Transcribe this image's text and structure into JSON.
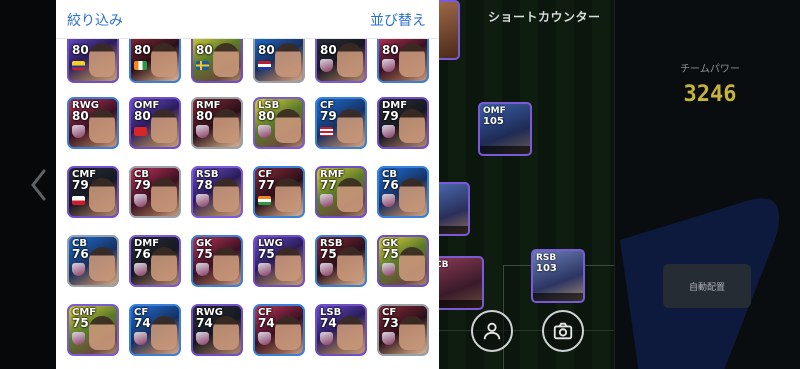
{
  "panel": {
    "filter_label": "絞り込み",
    "sort_label": "並び替え"
  },
  "background": {
    "formation_title": "ショートカウンター",
    "team_power_label": "チームパワー",
    "team_power_value": "3246",
    "auto_assign_label": "自動配置",
    "pitch_players": [
      {
        "pos": "OMF",
        "rating": "105"
      },
      {
        "pos": "RSB",
        "rating": "103"
      },
      {
        "pos": "CB",
        "rating": ""
      },
      {
        "pos": "",
        "rating": ""
      },
      {
        "pos": "",
        "rating": ""
      }
    ]
  },
  "roster": [
    {
      "pos": "",
      "rating": "80",
      "badge": "flag-colombia"
    },
    {
      "pos": "",
      "rating": "80",
      "badge": "flag-ivory-coast"
    },
    {
      "pos": "",
      "rating": "80",
      "badge": "flag-sweden"
    },
    {
      "pos": "",
      "rating": "80",
      "badge": "flag-netherlands"
    },
    {
      "pos": "",
      "rating": "80",
      "badge": "club-crest"
    },
    {
      "pos": "",
      "rating": "80",
      "badge": "club-crest"
    },
    {
      "pos": "RWG",
      "rating": "80",
      "badge": "club-crest"
    },
    {
      "pos": "OMF",
      "rating": "80",
      "badge": "flag-switzerland"
    },
    {
      "pos": "RMF",
      "rating": "80",
      "badge": "club-crest"
    },
    {
      "pos": "LSB",
      "rating": "80",
      "badge": "club-crest"
    },
    {
      "pos": "CF",
      "rating": "79",
      "badge": "flag-malaysia"
    },
    {
      "pos": "DMF",
      "rating": "79",
      "badge": "club-crest"
    },
    {
      "pos": "CMF",
      "rating": "79",
      "badge": "flag-czech"
    },
    {
      "pos": "CB",
      "rating": "79",
      "badge": "club-crest"
    },
    {
      "pos": "RSB",
      "rating": "78",
      "badge": "club-crest"
    },
    {
      "pos": "CF",
      "rating": "77",
      "badge": "flag-india"
    },
    {
      "pos": "RMF",
      "rating": "77",
      "badge": "club-crest"
    },
    {
      "pos": "CB",
      "rating": "76",
      "badge": "club-crest"
    },
    {
      "pos": "CB",
      "rating": "76",
      "badge": "club-crest"
    },
    {
      "pos": "DMF",
      "rating": "76",
      "badge": "club-crest"
    },
    {
      "pos": "GK",
      "rating": "75",
      "badge": "club-crest"
    },
    {
      "pos": "LWG",
      "rating": "75",
      "badge": "club-crest"
    },
    {
      "pos": "RSB",
      "rating": "75",
      "badge": "club-crest"
    },
    {
      "pos": "GK",
      "rating": "75",
      "badge": "club-crest"
    },
    {
      "pos": "CMF",
      "rating": "75",
      "badge": "club-crest"
    },
    {
      "pos": "CF",
      "rating": "74",
      "badge": "club-crest"
    },
    {
      "pos": "RWG",
      "rating": "74",
      "badge": "club-crest"
    },
    {
      "pos": "CF",
      "rating": "74",
      "badge": "club-crest"
    },
    {
      "pos": "LSB",
      "rating": "74",
      "badge": "club-crest"
    },
    {
      "pos": "CF",
      "rating": "73",
      "badge": "club-crest"
    }
  ],
  "icons": {
    "left_arrow": "chevron-left-icon",
    "user": "user-icon",
    "camera": "camera-icon"
  },
  "colors": {
    "accent_blue": "#2a6fd1",
    "team_power": "#c7b43a",
    "card_border_purple": "#6f4ec9",
    "card_border_blue": "#3a7fd9",
    "card_border_silver": "#9aa0a8"
  }
}
